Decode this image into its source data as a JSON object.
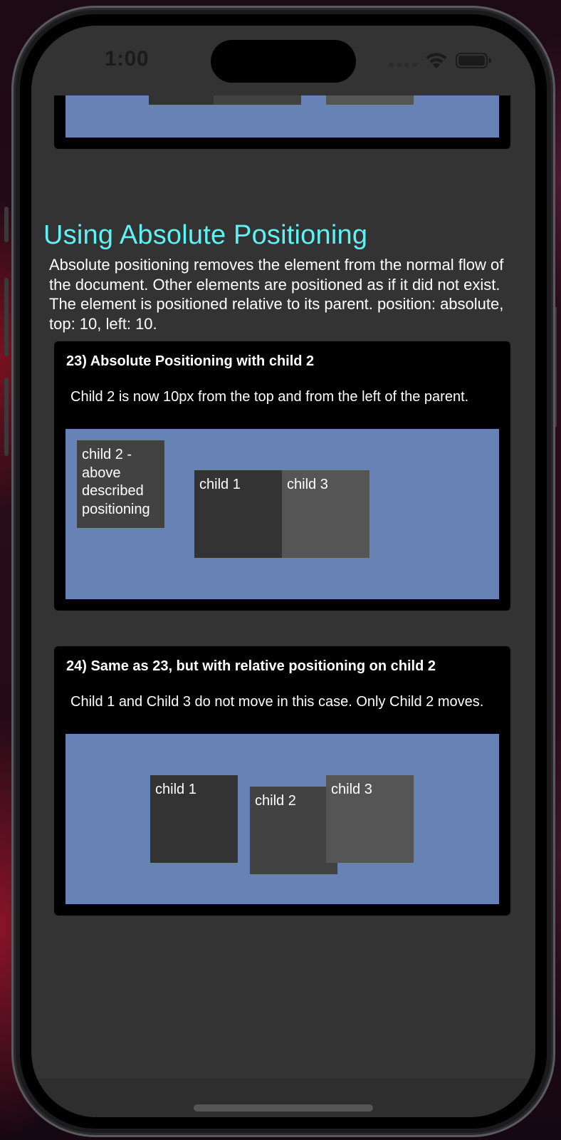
{
  "status_bar": {
    "time": "1:00"
  },
  "section": {
    "heading": "Using Absolute Positioning",
    "paragraph": "Absolute positioning removes the element from the normal flow of the document. Other elements are positioned as if it did not exist. The element is positioned relative to its parent. position: absolute, top: 10, left: 10."
  },
  "example_23": {
    "title": "23) Absolute Positioning with child 2",
    "description": "Child 2 is now 10px from the top and from the left of the parent.",
    "child_2_label": "child 2 - above described positioning",
    "child_1_label": "child 1",
    "child_3_label": "child 3"
  },
  "example_24": {
    "title": "24) Same as 23, but with relative positioning on child 2",
    "description": "Child 1 and Child 3 do not move in this case. Only Child 2 moves.",
    "child_1_label": "child 1",
    "child_2_label": "child 2",
    "child_3_label": "child 3"
  },
  "colors": {
    "heading": "#5ff1f4",
    "stage": "#6783b5",
    "child_1": "#333333",
    "child_2": "#424242",
    "child_3": "#555555",
    "box": "#000000",
    "screen_bg": "#333333"
  },
  "icons": {
    "wifi": "wifi-icon",
    "battery": "battery-icon",
    "signal": "signal-dots-icon"
  }
}
